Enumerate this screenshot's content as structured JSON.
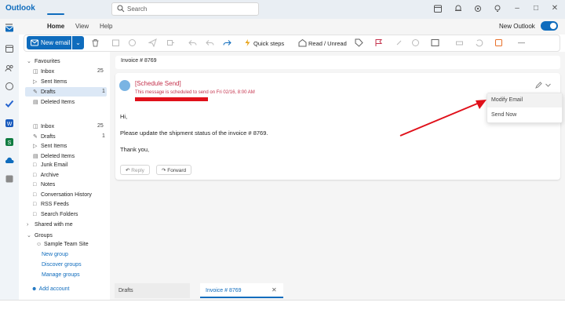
{
  "app": {
    "title": "Outlook"
  },
  "search": {
    "placeholder": "Search"
  },
  "menu": {
    "tabs": [
      "Home",
      "View",
      "Help"
    ],
    "new_outlook_label": "New Outlook"
  },
  "ribbon": {
    "new_email": "New email",
    "quick_steps": "Quick steps",
    "read_unread": "Read / Unread"
  },
  "favorites": {
    "header": "Favourites",
    "items": [
      {
        "label": "Inbox",
        "count": "25"
      },
      {
        "label": "Sent Items",
        "count": ""
      },
      {
        "label": "Drafts",
        "count": "1"
      },
      {
        "label": "Deleted Items",
        "count": ""
      }
    ]
  },
  "folders": {
    "items": [
      {
        "label": "Inbox",
        "count": "25"
      },
      {
        "label": "Drafts",
        "count": "1"
      },
      {
        "label": "Sent Items",
        "count": ""
      },
      {
        "label": "Deleted Items",
        "count": ""
      },
      {
        "label": "Junk Email",
        "count": ""
      },
      {
        "label": "Archive",
        "count": ""
      },
      {
        "label": "Notes",
        "count": ""
      },
      {
        "label": "Conversation History",
        "count": ""
      },
      {
        "label": "RSS Feeds",
        "count": ""
      },
      {
        "label": "Search Folders",
        "count": ""
      }
    ],
    "shared": "Shared with me",
    "groups": "Groups",
    "group_site": "Sample Team Site",
    "new_group": "New group",
    "discover_groups": "Discover groups",
    "manage_groups": "Manage groups",
    "add_account": "Add account"
  },
  "message": {
    "subject": "Invoice # 8769",
    "scheduled_title": "[Schedule Send]",
    "scheduled_note": "This message is scheduled to send on Fri 02/16, 8:00 AM",
    "greeting": "Hi,",
    "body": "Please update the shipment status of the invoice # 8769.",
    "closing": "Thank you,",
    "reply": "Reply",
    "forward": "Forward"
  },
  "dropdown": {
    "items": [
      "Modify Email",
      "Send Now"
    ]
  },
  "bottom_tabs": [
    "Drafts",
    "Invoice # 8769"
  ],
  "colors": {
    "accent": "#0f6cbd",
    "schedule_red": "#c4314b",
    "arrow_red": "#e0101a"
  }
}
